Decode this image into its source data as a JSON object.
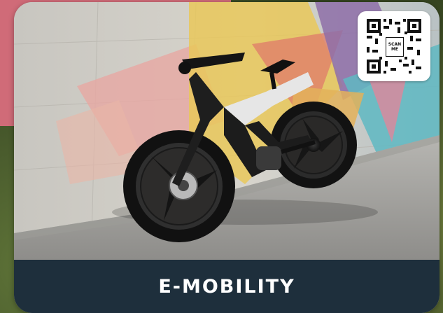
{
  "card": {
    "caption": "E-MOBILITY"
  },
  "qr": {
    "line1": "SCAN",
    "line2": "ME"
  },
  "icons": {
    "qr": "qr-code-icon",
    "bike": "electric-bike-illustration"
  },
  "colors": {
    "caption_bar": "#1e2f3c",
    "caption_text": "#ffffff",
    "pink_accent": "#d06b78",
    "qr_background": "#ffffff"
  }
}
